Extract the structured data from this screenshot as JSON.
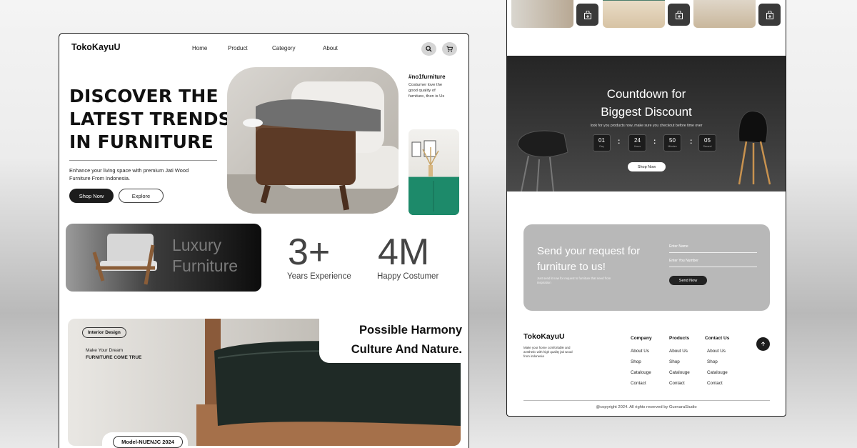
{
  "left_page": {
    "nav": {
      "logo": "TokoKayuU",
      "links": [
        "Home",
        "Product",
        "Category",
        "About"
      ]
    },
    "hero": {
      "title": "DISCOVER THE LATEST TRENDS IN FURNITURE",
      "subtitle": "Enhance your living space with premium Jati Wood Furniture From Indonesia.",
      "primary_button": "Shop Now",
      "secondary_button": "Explore",
      "side_tag": "#no1furniture",
      "side_text": "Costumer love the good quality of furniture, then is Us"
    },
    "luxury_card": {
      "line1": "Luxury",
      "line2": "Furniture"
    },
    "stats": [
      {
        "value": "3+",
        "label": "Years Experience"
      },
      {
        "value": "4M",
        "label": "Happy Costumer"
      }
    ],
    "feature": {
      "headline_line1": "Possible Harmony",
      "headline_line2": "Culture And  Nature.",
      "tag": "Interior Design",
      "dream_line1": "Make Your Dream",
      "dream_line2": "FURNITURE COME TRUE",
      "model": "Model-NUENJC 2024"
    }
  },
  "right_page": {
    "countdown": {
      "title_line1": "Countdown for",
      "title_line2": "Biggest Discount",
      "subtitle": "look for you products now, make sure you checkout before  time over",
      "units": [
        {
          "value": "01",
          "unit": "Day"
        },
        {
          "value": "24",
          "unit": "Hours"
        },
        {
          "value": "50",
          "unit": "Minutes"
        },
        {
          "value": "05",
          "unit": "Second"
        }
      ],
      "button": "Shop Now"
    },
    "request": {
      "title": "Send your request for furniture to us!",
      "small_text": "Just send it now for request to furniture that need from inspiration",
      "name_placeholder": "Enter Name",
      "number_placeholder": "Enter You Number",
      "button": "Send Now"
    },
    "footer": {
      "logo": "TokoKayuU",
      "description": "Make your home comfortable and aesthetic with high quality jati wood from indonesia",
      "columns": [
        {
          "heading": "Company",
          "items": [
            "About Us",
            "Shop",
            "Catalouge",
            "Contact"
          ]
        },
        {
          "heading": "Products",
          "items": [
            "About Us",
            "Shop",
            "Catalouge",
            "Contact"
          ]
        },
        {
          "heading": "Contact Us",
          "items": [
            "About Us",
            "Shop",
            "Catalouge",
            "Contact"
          ]
        }
      ],
      "copyright": "@copyright 2024. All rights reserved by GuevaraStudio"
    }
  },
  "colors": {
    "dark": "#1c1c1c",
    "accent_green": "#1f8a6b",
    "card_grey": "#b8b8b8"
  }
}
